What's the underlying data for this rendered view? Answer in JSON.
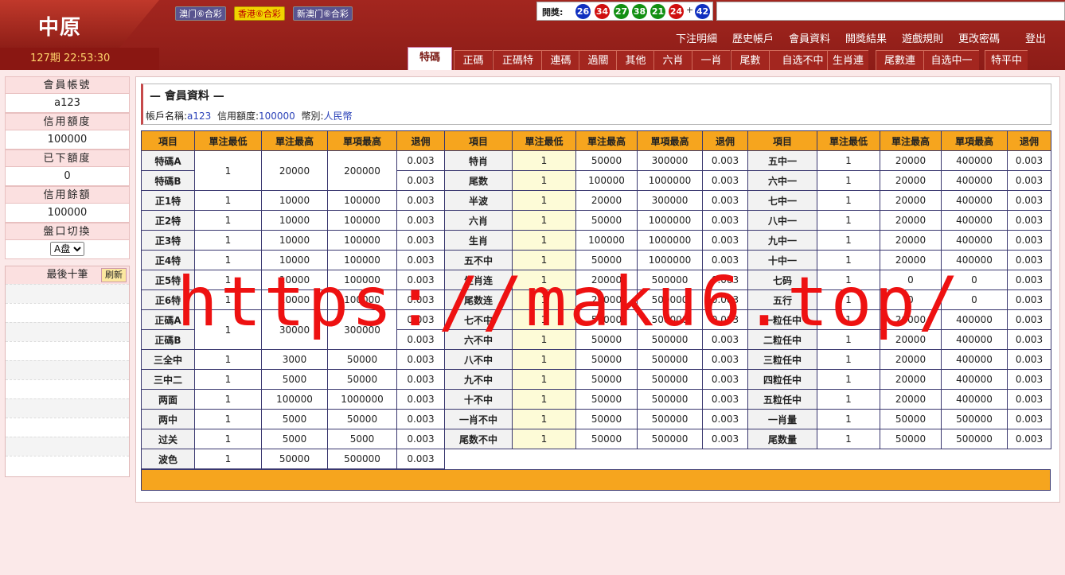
{
  "app": {
    "logo": "中原",
    "period": "127期 22:53:30"
  },
  "lotteries": [
    "澳门⑥合彩",
    "香港⑥合彩",
    "新澳门⑥合彩"
  ],
  "draw": {
    "label": "開獎:",
    "balls": [
      "26",
      "34",
      "27",
      "38",
      "21",
      "24"
    ],
    "special": "42",
    "plus": "+",
    "colors": [
      "blue",
      "red",
      "green",
      "green",
      "green",
      "red",
      "blue"
    ]
  },
  "toplinks": [
    "下注明細",
    "歷史帳戶",
    "會員資料",
    "開獎結果",
    "遊戲規則",
    "更改密碼",
    "登出"
  ],
  "tabs": [
    "特碼",
    "正碼",
    "正碼特",
    "連碼",
    "過關",
    "其他",
    "六肖",
    "一肖",
    "尾數",
    "自选不中",
    "生肖連",
    "尾數連",
    "自选中一",
    "特平中"
  ],
  "sidebar": {
    "account_label": "會員帳號",
    "account": "a123",
    "credit_label": "信用額度",
    "credit": "100000",
    "placed_label": "已下額度",
    "placed": "0",
    "balance_label": "信用餘額",
    "balance": "100000",
    "switch_label": "盤口切換",
    "switch_value": "A盘",
    "recent_label": "最後十筆",
    "refresh": "刷新"
  },
  "info": {
    "title": "— 會員資料 —",
    "name_label": "帳戶名稱:",
    "name": "a123",
    "credit_label": "信用額度:",
    "credit": "100000",
    "currency_label": "幣別:",
    "currency": "人民幣"
  },
  "headers": [
    "項目",
    "單注最低",
    "單注最高",
    "單項最高",
    "退佣"
  ],
  "table1": [
    [
      "特碼A",
      "1",
      "20000",
      "200000",
      "0.003"
    ],
    [
      "特碼B",
      "",
      "",
      "",
      "0.003"
    ],
    [
      "正1特",
      "1",
      "10000",
      "100000",
      "0.003"
    ],
    [
      "正2特",
      "1",
      "10000",
      "100000",
      "0.003"
    ],
    [
      "正3特",
      "1",
      "10000",
      "100000",
      "0.003"
    ],
    [
      "正4特",
      "1",
      "10000",
      "100000",
      "0.003"
    ],
    [
      "正5特",
      "1",
      "10000",
      "100000",
      "0.003"
    ],
    [
      "正6特",
      "1",
      "10000",
      "100000",
      "0.003"
    ],
    [
      "正碼A",
      "1",
      "30000",
      "300000",
      "0.003"
    ],
    [
      "正碼B",
      "",
      "",
      "",
      "0.003"
    ],
    [
      "三全中",
      "1",
      "3000",
      "50000",
      "0.003"
    ],
    [
      "三中二",
      "1",
      "5000",
      "50000",
      "0.003"
    ],
    [
      "两面",
      "1",
      "100000",
      "1000000",
      "0.003"
    ],
    [
      "两中",
      "1",
      "5000",
      "50000",
      "0.003"
    ],
    [
      "过关",
      "1",
      "5000",
      "5000",
      "0.003"
    ],
    [
      "波色",
      "1",
      "50000",
      "500000",
      "0.003"
    ]
  ],
  "table2": [
    [
      "特肖",
      "1",
      "50000",
      "300000",
      "0.003"
    ],
    [
      "尾数",
      "1",
      "100000",
      "1000000",
      "0.003"
    ],
    [
      "半波",
      "1",
      "20000",
      "300000",
      "0.003"
    ],
    [
      "六肖",
      "1",
      "50000",
      "1000000",
      "0.003"
    ],
    [
      "生肖",
      "1",
      "100000",
      "1000000",
      "0.003"
    ],
    [
      "五不中",
      "1",
      "50000",
      "1000000",
      "0.003"
    ],
    [
      "生肖连",
      "1",
      "20000",
      "500000",
      "0.003"
    ],
    [
      "尾数连",
      "1",
      "20000",
      "500000",
      "0.003"
    ],
    [
      "七不中",
      "1",
      "50000",
      "500000",
      "0.003"
    ],
    [
      "六不中",
      "1",
      "50000",
      "500000",
      "0.003"
    ],
    [
      "八不中",
      "1",
      "50000",
      "500000",
      "0.003"
    ],
    [
      "九不中",
      "1",
      "50000",
      "500000",
      "0.003"
    ],
    [
      "十不中",
      "1",
      "50000",
      "500000",
      "0.003"
    ],
    [
      "一肖不中",
      "1",
      "50000",
      "500000",
      "0.003"
    ],
    [
      "尾数不中",
      "1",
      "50000",
      "500000",
      "0.003"
    ]
  ],
  "table3": [
    [
      "五中一",
      "1",
      "20000",
      "400000",
      "0.003"
    ],
    [
      "六中一",
      "1",
      "20000",
      "400000",
      "0.003"
    ],
    [
      "七中一",
      "1",
      "20000",
      "400000",
      "0.003"
    ],
    [
      "八中一",
      "1",
      "20000",
      "400000",
      "0.003"
    ],
    [
      "九中一",
      "1",
      "20000",
      "400000",
      "0.003"
    ],
    [
      "十中一",
      "1",
      "20000",
      "400000",
      "0.003"
    ],
    [
      "七码",
      "1",
      "0",
      "0",
      "0.003"
    ],
    [
      "五行",
      "1",
      "0",
      "0",
      "0.003"
    ],
    [
      "一粒任中",
      "1",
      "20000",
      "400000",
      "0.003"
    ],
    [
      "二粒任中",
      "1",
      "20000",
      "400000",
      "0.003"
    ],
    [
      "三粒任中",
      "1",
      "20000",
      "400000",
      "0.003"
    ],
    [
      "四粒任中",
      "1",
      "20000",
      "400000",
      "0.003"
    ],
    [
      "五粒任中",
      "1",
      "20000",
      "400000",
      "0.003"
    ],
    [
      "一肖量",
      "1",
      "50000",
      "500000",
      "0.003"
    ],
    [
      "尾数量",
      "1",
      "50000",
      "500000",
      "0.003"
    ]
  ],
  "watermark": "https://maku6.top/"
}
